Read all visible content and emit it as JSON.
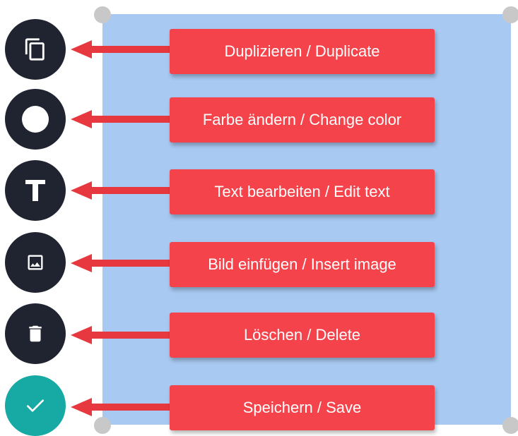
{
  "toolbar": {
    "items": [
      {
        "icon": "duplicate-icon",
        "label": "Duplizieren / Duplicate"
      },
      {
        "icon": "circle-color-icon",
        "label": "Farbe ändern / Change color"
      },
      {
        "icon": "text-t-icon",
        "label": "Text bearbeiten / Edit text"
      },
      {
        "icon": "image-icon",
        "label": "Bild einfügen / Insert image"
      },
      {
        "icon": "trash-icon",
        "label": "Löschen / Delete"
      },
      {
        "icon": "checkmark-icon",
        "label": "Speichern / Save"
      }
    ]
  },
  "colors": {
    "panel": "#a8c9f2",
    "button_dark": "#1f2430",
    "button_save": "#17a9a3",
    "callout": "#f4434a",
    "arrow": "#e8383f"
  }
}
